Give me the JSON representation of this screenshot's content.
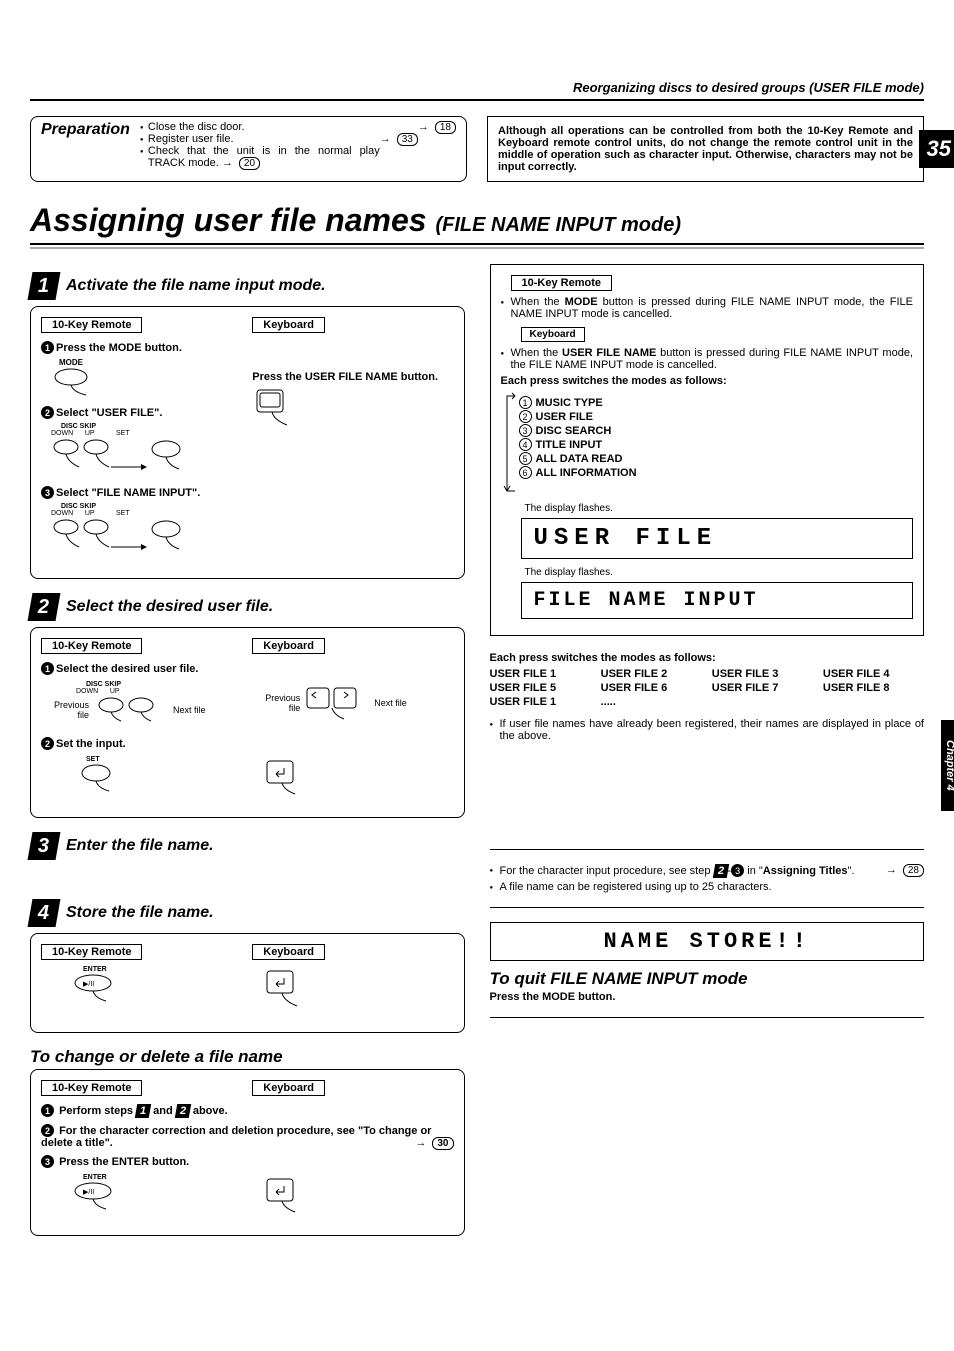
{
  "header": {
    "breadcrumb": "Reorganizing discs to desired groups (USER FILE mode)"
  },
  "pageNumber": "35",
  "chapterTab": "Chapter 4",
  "preparation": {
    "title": "Preparation",
    "items": [
      {
        "text": "Close the disc door.",
        "ref": "18"
      },
      {
        "text": "Register user file.",
        "ref": "33"
      },
      {
        "text": "Check that the unit is in the normal play TRACK mode.",
        "ref": "20"
      }
    ]
  },
  "warning": "Although all operations can be controlled from both the 10-Key Remote and Keyboard remote control units, do not change the remote control unit in the middle of operation such as character input. Otherwise, characters may not be input correctly.",
  "mainTitle": {
    "a": "Assigning user file names ",
    "b": "(FILE NAME INPUT mode)"
  },
  "labels": {
    "tenKey": "10-Key Remote",
    "keyboard": "Keyboard"
  },
  "step1": {
    "title": "Activate the file name input mode.",
    "i1": "Press the MODE button.",
    "i2": "Select \"USER FILE\".",
    "i3": "Select \"FILE NAME INPUT\".",
    "kb": "Press the USER FILE NAME  button.",
    "modeLabel": "MODE",
    "discSkip": "DISC SKIP",
    "down": "DOWN",
    "up": "UP",
    "set": "SET"
  },
  "step2": {
    "title": "Select the desired user file.",
    "i1": "Select the desired user file.",
    "i2": "Set the input.",
    "prev": "Previous file",
    "next": "Next file"
  },
  "step3": {
    "title": "Enter the file name."
  },
  "step4": {
    "title": "Store the file name.",
    "enter": "ENTER"
  },
  "changeDelete": {
    "title": "To change or delete a file name",
    "l1a": "Perform steps ",
    "l1b": " and ",
    "l1c": " above.",
    "l2": "For the character correction and deletion procedure, see \"To change or delete a title\".",
    "l2ref": "30",
    "l3": "Press the ENTER button."
  },
  "rightTop": {
    "note1a": "When the ",
    "note1b": "MODE",
    "note1c": " button is pressed during FILE NAME INPUT mode, the  FILE NAME INPUT  mode is cancelled.",
    "note2a": "When the ",
    "note2b": "USER FILE NAME",
    "note2c": " button is pressed during FILE NAME INPUT mode, the  FILE NAME INPUT  mode is cancelled.",
    "switchHead": "Each press switches the modes as follows:",
    "modes": [
      "MUSIC TYPE",
      "USER FILE",
      "DISC SEARCH",
      "TITLE INPUT",
      "ALL DATA READ",
      "ALL INFORMATION"
    ],
    "flash": "The display flashes.",
    "lcd1": "USER FILE",
    "lcd2": "FILE NAME INPUT"
  },
  "userFiles": {
    "head": "Each press switches the modes as follows:",
    "items": [
      "USER FILE 1",
      "USER FILE 2",
      "USER FILE 3",
      "USER FILE 4",
      "USER FILE 5",
      "USER FILE 6",
      "USER FILE 7",
      "USER FILE 8",
      "USER FILE 1",
      "....."
    ],
    "note": "If user file names have already been registered, their names are displayed in place of the above."
  },
  "step3Right": {
    "n1a": "For the character input procedure, see step ",
    "n1b": "-",
    "n1c": " in \"",
    "n1d": "Assigning Titles",
    "n1e": "\".",
    "ref": "28",
    "n2": "A file name can be registered using up to 25 characters."
  },
  "step4Right": {
    "lcd": "NAME STORE!!",
    "quitTitle": "To quit FILE NAME INPUT mode",
    "quitBody": "Press the MODE button."
  }
}
